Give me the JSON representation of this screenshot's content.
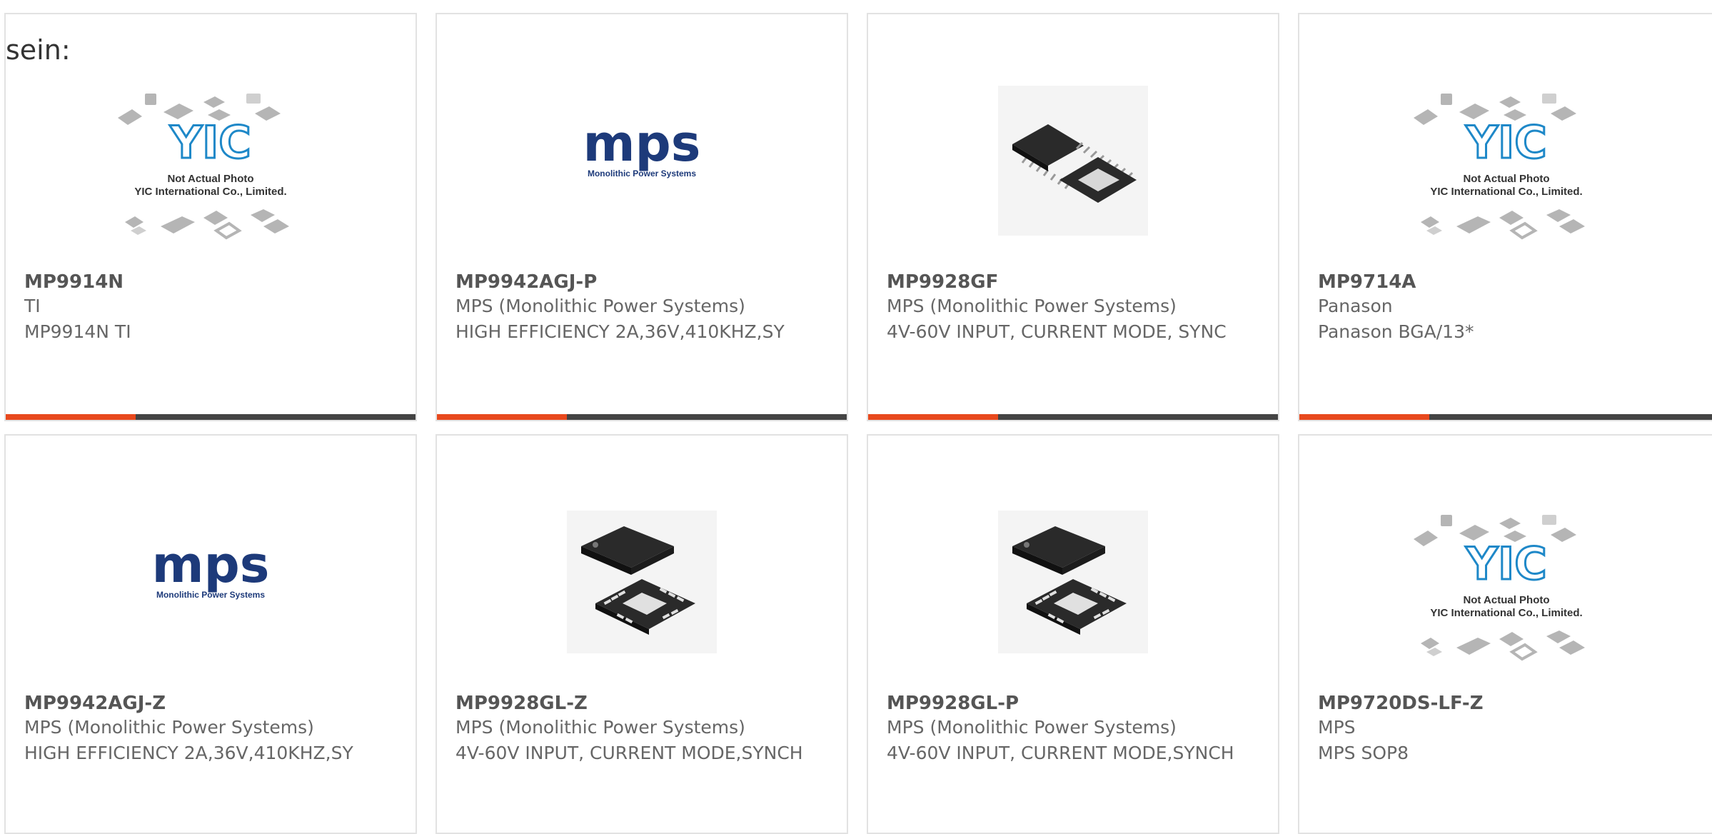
{
  "partial_heading": "sein:",
  "placeholder_image": {
    "line1": "Not Actual Photo",
    "line2": "YIC International Co., Limited.",
    "logo": "YIC"
  },
  "mps_logo": {
    "brand": "mps",
    "tagline": "Monolithic Power Systems"
  },
  "products": [
    {
      "part": "MP9914N",
      "manufacturer": "TI",
      "description": "MP9914N TI",
      "image": "placeholder"
    },
    {
      "part": "MP9942AGJ-P",
      "manufacturer": "MPS (Monolithic Power Systems)",
      "description": "HIGH EFFICIENCY 2A,36V,410KHZ,SY",
      "image": "mps-logo"
    },
    {
      "part": "MP9928GF",
      "manufacturer": "MPS (Monolithic Power Systems)",
      "description": "4V-60V INPUT, CURRENT MODE, SYNC",
      "image": "tssop-chip"
    },
    {
      "part": "MP9714A",
      "manufacturer": "Panason",
      "description": "Panason BGA/13*",
      "image": "placeholder"
    },
    {
      "part": "MP9942AGJ-Z",
      "manufacturer": "MPS (Monolithic Power Systems)",
      "description": "HIGH EFFICIENCY 2A,36V,410KHZ,SY",
      "image": "mps-logo"
    },
    {
      "part": "MP9928GL-Z",
      "manufacturer": "MPS (Monolithic Power Systems)",
      "description": "4V-60V INPUT, CURRENT MODE,SYNCH",
      "image": "qfn-chip"
    },
    {
      "part": "MP9928GL-P",
      "manufacturer": "MPS (Monolithic Power Systems)",
      "description": "4V-60V INPUT, CURRENT MODE,SYNCH",
      "image": "qfn-chip"
    },
    {
      "part": "MP9720DS-LF-Z",
      "manufacturer": "MPS",
      "description": "MPS SOP8",
      "image": "placeholder"
    }
  ],
  "colors": {
    "accent": "#e8491d",
    "bar_dark": "#444444",
    "mps_blue": "#1d3a7a",
    "yic_blue": "#1e88c8"
  }
}
